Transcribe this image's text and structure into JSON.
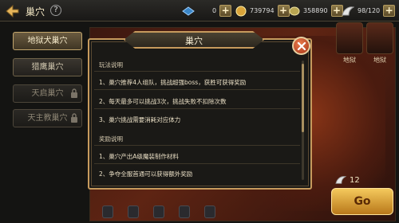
{
  "header": {
    "title": "巢穴",
    "help": "?",
    "resources": [
      {
        "name": "energy",
        "icon": "crystal-icon",
        "value": "0"
      },
      {
        "name": "gold",
        "icon": "coin-icon",
        "value": "739794"
      },
      {
        "name": "gems",
        "icon": "gem-icon",
        "value": "358890"
      },
      {
        "name": "stamina",
        "icon": "wing-icon",
        "value": "98/120"
      }
    ]
  },
  "sidebar": {
    "items": [
      {
        "label": "地狱犬巢穴",
        "state": "active"
      },
      {
        "label": "猎鹰巢穴",
        "state": "normal"
      },
      {
        "label": "天启巢穴",
        "state": "locked"
      },
      {
        "label": "天主教巢穴",
        "state": "locked"
      }
    ]
  },
  "scene": {
    "portraits": [
      {
        "label": "地狱"
      },
      {
        "label": "地狱"
      }
    ],
    "count": "12",
    "action_button": "Go"
  },
  "modal": {
    "title": "巢穴",
    "sections": [
      {
        "heading": "玩法说明",
        "lines": [
          "1、巢穴推荐4人组队，挑战超强boss，获胜可获得奖励",
          "2、每天最多可以挑战3次，挑战失败不扣除次数",
          "3、巢穴挑战需要消耗对应体力"
        ]
      },
      {
        "heading": "奖励说明",
        "lines": [
          "1、巢穴产出A级魔装制作材料",
          "2、争夺全服首通可以获得额外奖励"
        ]
      }
    ]
  },
  "colors": {
    "accent_gold": "#c69a5d",
    "close_red": "#c4461f",
    "action_gold": "#f4c95c"
  }
}
